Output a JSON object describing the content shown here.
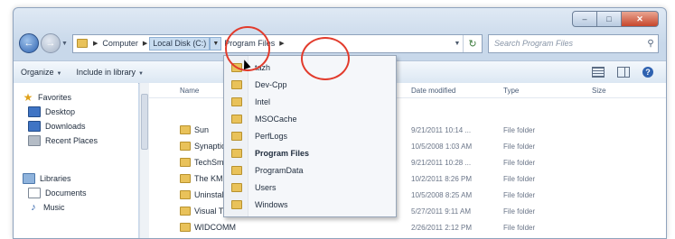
{
  "address_bar": {
    "crumbs": [
      "Computer",
      "Local Disk (C:)",
      "Program Files"
    ]
  },
  "search": {
    "placeholder": "Search Program Files"
  },
  "toolbar": {
    "organize": "Organize",
    "include_in_library": "Include in library"
  },
  "nav_pane": {
    "favorites": "Favorites",
    "desktop": "Desktop",
    "downloads": "Downloads",
    "recent_places": "Recent Places",
    "libraries": "Libraries",
    "documents": "Documents",
    "music": "Music"
  },
  "columns": {
    "name": "Name",
    "date_modified": "Date modified",
    "type": "Type",
    "size": "Size"
  },
  "files": [
    {
      "name": "Sun",
      "date": "9/21/2011 10:14 ...",
      "type": "File folder"
    },
    {
      "name": "Synaptics",
      "date": "10/5/2008 1:03 AM",
      "type": "File folder"
    },
    {
      "name": "TechSmith",
      "date": "9/21/2011 10:28 ...",
      "type": "File folder"
    },
    {
      "name": "The KMPlayer",
      "date": "10/2/2011 8:26 PM",
      "type": "File folder"
    },
    {
      "name": "Uninstall",
      "date": "10/5/2008 8:25 AM",
      "type": "File folder"
    },
    {
      "name": "Visual Th...",
      "date": "5/27/2011 9:11 AM",
      "type": "File folder"
    },
    {
      "name": "WIDCOMM",
      "date": "2/26/2011 2:12 PM",
      "type": "File folder"
    }
  ],
  "dropdown": {
    "items": [
      {
        "label": "tazh",
        "bold": false
      },
      {
        "label": "Dev-Cpp",
        "bold": false
      },
      {
        "label": "Intel",
        "bold": false
      },
      {
        "label": "MSOCache",
        "bold": false
      },
      {
        "label": "PerfLogs",
        "bold": false
      },
      {
        "label": "Program Files",
        "bold": true
      },
      {
        "label": "ProgramData",
        "bold": false
      },
      {
        "label": "Users",
        "bold": false
      },
      {
        "label": "Windows",
        "bold": false
      }
    ]
  },
  "colors": {
    "highlight_circle": "#e23b2c",
    "folder": "#e9c25a",
    "chrome": "#c8d8ea"
  }
}
